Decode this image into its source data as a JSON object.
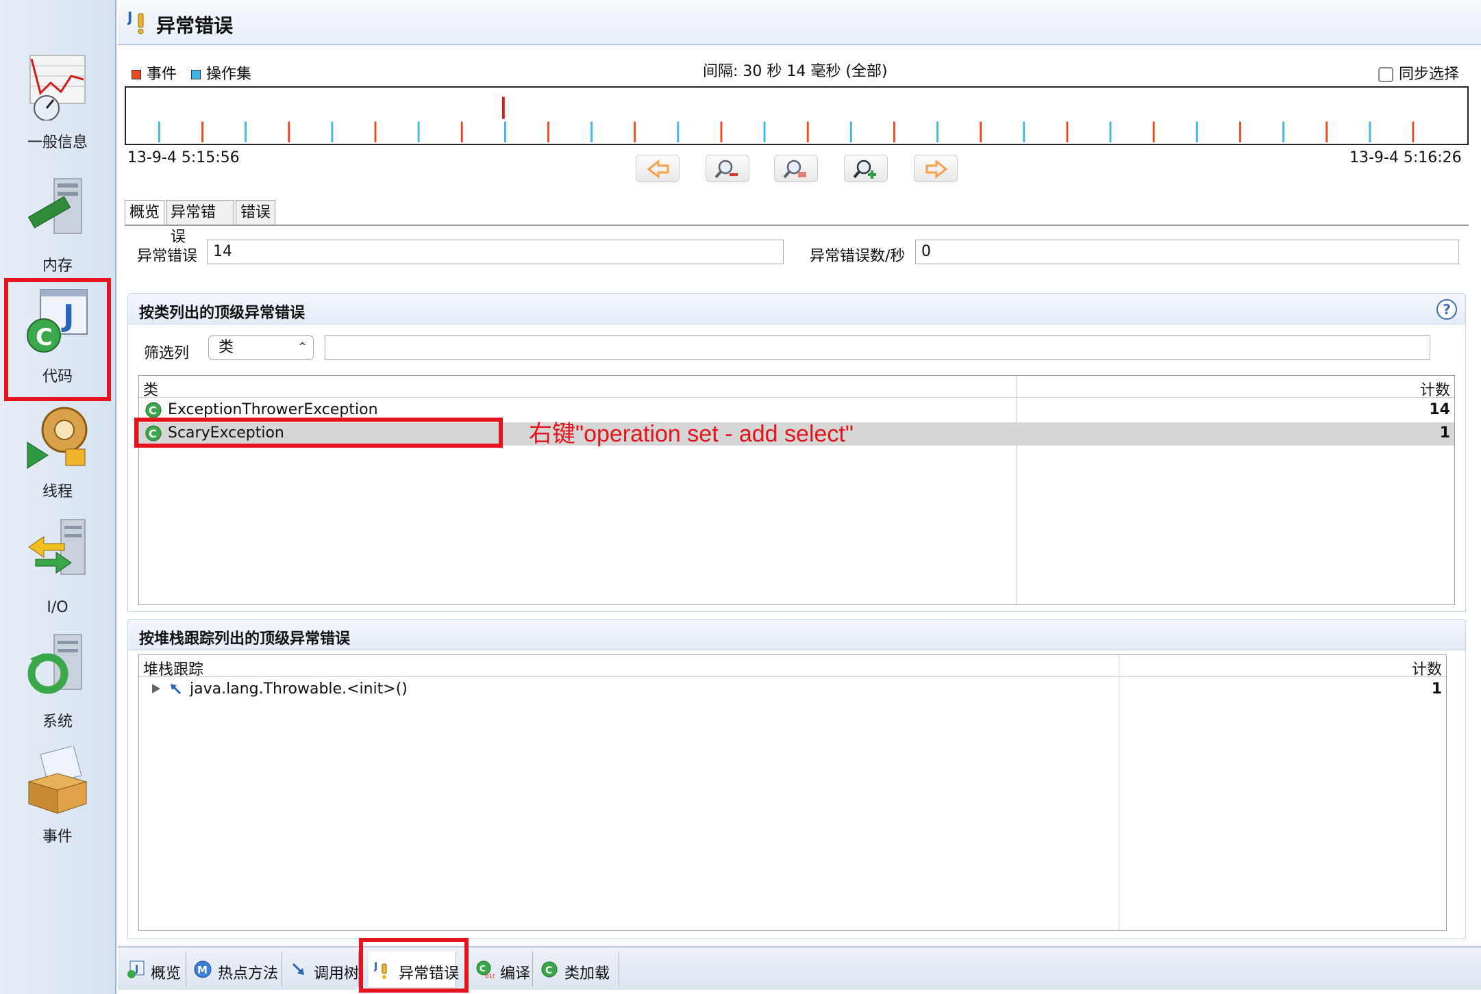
{
  "sidebar": {
    "items": [
      {
        "label": "一般信息",
        "icon": "gauge-chart-icon"
      },
      {
        "label": "内存",
        "icon": "memory-server-icon"
      },
      {
        "label": "代码",
        "icon": "java-class-icon"
      },
      {
        "label": "线程",
        "icon": "thread-gear-lock-icon"
      },
      {
        "label": "I/O",
        "icon": "io-arrows-server-icon"
      },
      {
        "label": "系统",
        "icon": "system-refresh-icon"
      },
      {
        "label": "事件",
        "icon": "event-box-icon"
      }
    ]
  },
  "header": {
    "title": "异常错误",
    "icon": "exception-icon"
  },
  "timeline": {
    "legend_event": "事件",
    "legend_opset": "操作集",
    "event_color": "#e8491d",
    "opset_color": "#3fb6e6",
    "interval": "间隔: 30 秒 14 毫秒 (全部)",
    "sync_label": "同步选择",
    "start": "13-9-4 5:15:56",
    "end": "13-9-4 5:16:26",
    "nav_buttons": [
      "left-arrow-icon",
      "zoom-out-icon",
      "zoom-reset-icon",
      "zoom-in-icon",
      "right-arrow-icon"
    ]
  },
  "tabs": [
    "概览",
    "异常错误",
    "错误"
  ],
  "summary": {
    "exceptions_label": "异常错误",
    "exceptions_value": "14",
    "rate_label": "异常错误数/秒",
    "rate_value": "0"
  },
  "by_class": {
    "title": "按类列出的顶级异常错误",
    "help": "?",
    "filter_label": "筛选列",
    "filter_selected": "类",
    "filter_text": "",
    "columns": [
      "类",
      "计数"
    ],
    "rows": [
      {
        "name": "ExceptionThrowerException",
        "count": "14"
      },
      {
        "name": "ScaryException",
        "count": "1"
      }
    ]
  },
  "annotation": "右键\"operation set - add select\"",
  "by_stack": {
    "title": "按堆栈跟踪列出的顶级异常错误",
    "columns": [
      "堆栈跟踪",
      "计数"
    ],
    "rows": [
      {
        "name": "java.lang.Throwable.<init>()",
        "count": "1"
      }
    ]
  },
  "bottom_tabs": [
    {
      "label": "概览",
      "icon": "overview-icon"
    },
    {
      "label": "热点方法",
      "icon": "method-icon"
    },
    {
      "label": "调用树",
      "icon": "call-tree-icon"
    },
    {
      "label": "异常错误",
      "icon": "exception-icon"
    },
    {
      "label": "编译",
      "icon": "compile-icon"
    },
    {
      "label": "类加载",
      "icon": "class-load-icon"
    }
  ]
}
